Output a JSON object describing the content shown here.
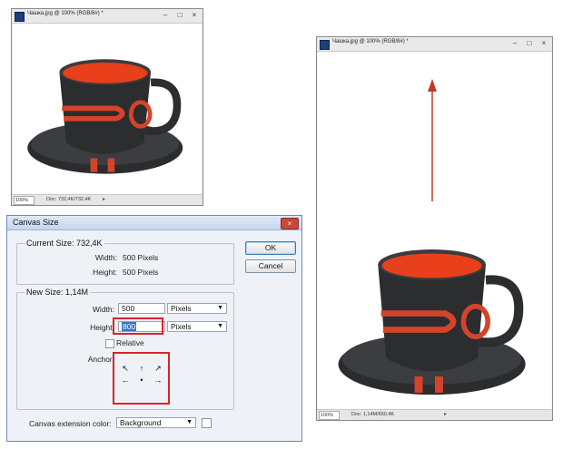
{
  "small_window": {
    "title": "Чашка.jpg @ 100% (RGB/8#) *",
    "zoom": "100%",
    "doc_info": "Doc: 732,4K/732,4K"
  },
  "large_window": {
    "title": "Чашка.jpg @ 100% (RGB/8#) *",
    "zoom": "100%",
    "doc_info": "Doc: 1,14M/650,4K"
  },
  "window_buttons": {
    "minimize": "–",
    "restore": "□",
    "close": "×"
  },
  "dialog": {
    "title": "Canvas Size",
    "close": "×",
    "current_size": {
      "legend": "Current Size: 732,4K",
      "width_label": "Width:",
      "width_value": "500 Pixels",
      "height_label": "Height:",
      "height_value": "500 Pixels"
    },
    "new_size": {
      "legend": "New Size: 1,14M",
      "width_label": "Width:",
      "width_value": "500",
      "width_unit": "Pixels",
      "height_label": "Height:",
      "height_value": "800",
      "height_unit": "Pixels",
      "relative_label": "Relative",
      "anchor_label": "Anchor:",
      "anchor_arrows": [
        "↖",
        "↑",
        "↗",
        "←",
        "•",
        "→",
        "",
        "",
        ""
      ]
    },
    "ok_label": "OK",
    "cancel_label": "Cancel",
    "extension_label": "Canvas extension color:",
    "extension_value": "Background"
  },
  "colors": {
    "cup_body": "#2b2d2f",
    "cup_rim_inner": "#e8401a",
    "decoration": "#d3442b",
    "annotation_red": "#d9232d",
    "arrow": "#c0392b"
  }
}
